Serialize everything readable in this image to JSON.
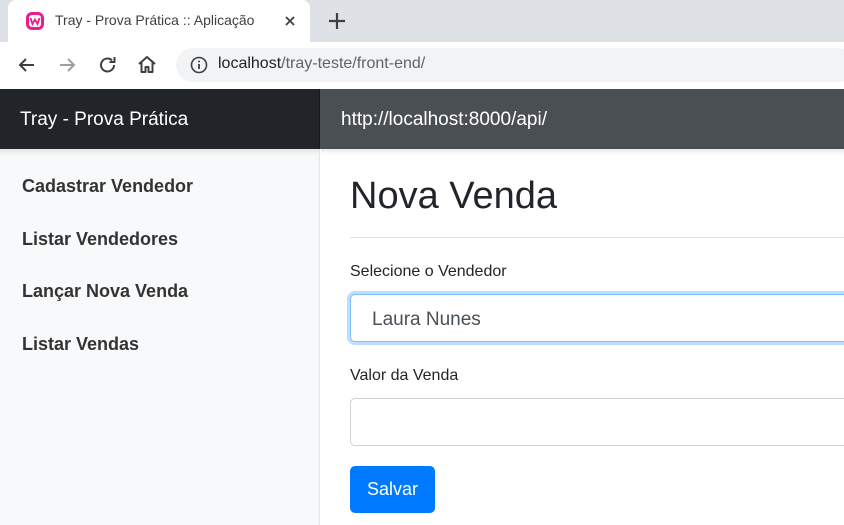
{
  "browser": {
    "tab": {
      "title": "Tray - Prova Prática :: Aplicação",
      "favicon": "wampserver-icon"
    },
    "address_bar": {
      "host": "localhost",
      "path": "/tray-teste/front-end/"
    },
    "icons": [
      "back-arrow-icon",
      "forward-arrow-icon",
      "reload-icon",
      "home-icon",
      "info-icon",
      "close-icon",
      "plus-icon"
    ]
  },
  "navbar": {
    "brand": "Tray - Prova Prática",
    "api_url": "http://localhost:8000/api/"
  },
  "sidebar": {
    "items": [
      {
        "label": "Cadastrar Vendedor"
      },
      {
        "label": "Listar Vendedores"
      },
      {
        "label": "Lançar Nova Venda"
      },
      {
        "label": "Listar Vendas"
      }
    ]
  },
  "main": {
    "title": "Nova Venda",
    "seller": {
      "label": "Selecione o Vendedor",
      "value": "Laura Nunes"
    },
    "amount": {
      "label": "Valor da Venda",
      "value": ""
    },
    "save_label": "Salvar"
  },
  "colors": {
    "brand_bg": "#212529",
    "navbar_bg": "#4a4f54",
    "primary": "#007bff",
    "favicon": "#e91e8c"
  }
}
